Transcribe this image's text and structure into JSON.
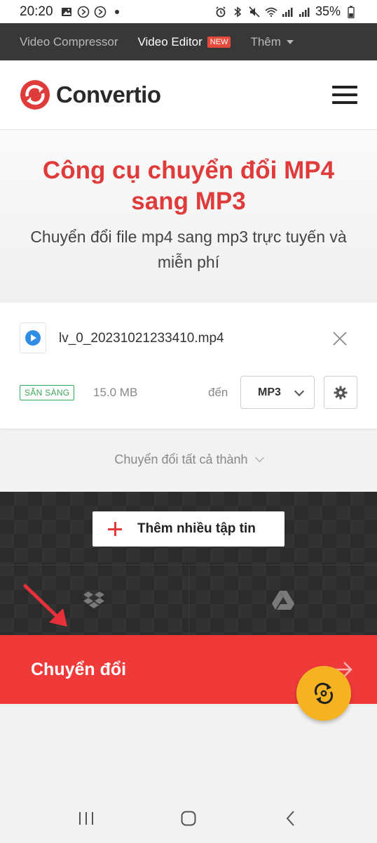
{
  "status_bar": {
    "time": "20:20",
    "battery": "35%"
  },
  "topnav": {
    "items": [
      {
        "label": "Video Compressor"
      },
      {
        "label": "Video Editor",
        "badge": "NEW"
      },
      {
        "label": "Thêm"
      }
    ]
  },
  "header": {
    "logo_text": "Convertio",
    "brand_color": "#e03b3b"
  },
  "hero": {
    "title": "Công cụ chuyển đổi MP4 sang MP3",
    "subtitle": "Chuyển đổi file mp4 sang mp3 trực tuyến và miễn phí"
  },
  "file": {
    "name": "lv_0_20231021233410.mp4",
    "status": "SẴN SÀNG",
    "size": "15.0 MB",
    "to_label": "đến",
    "format": "MP3"
  },
  "convert_all": {
    "label": "Chuyển đổi tất cả thành"
  },
  "uploader": {
    "add_files_label": "Thêm nhiều tập tin"
  },
  "convert": {
    "label": "Chuyển đổi",
    "color": "#f03a3a"
  },
  "icons": {
    "fab": "refresh-icon",
    "dropbox": "dropbox-icon",
    "gdrive": "google-drive-icon"
  }
}
